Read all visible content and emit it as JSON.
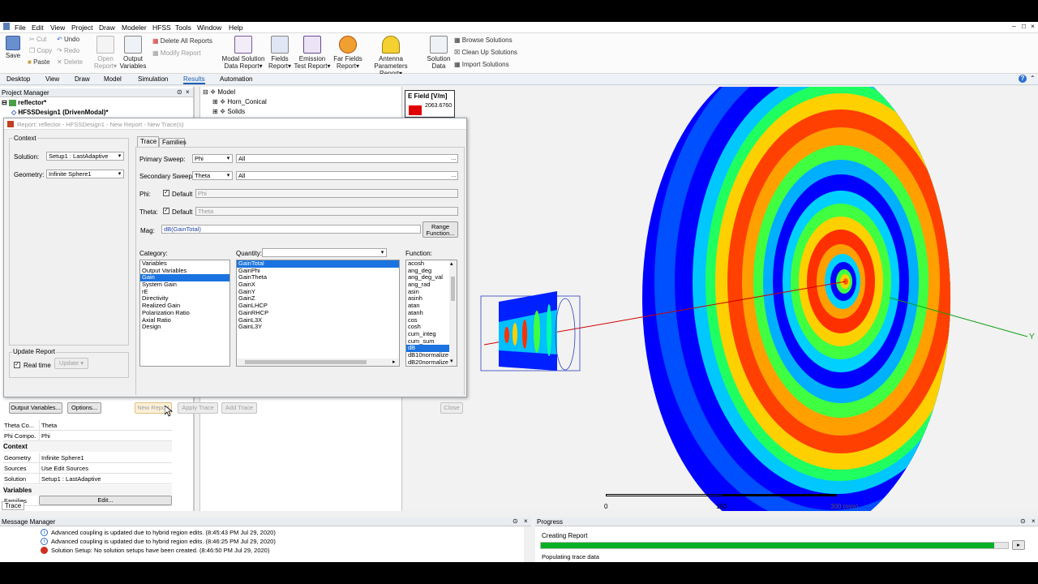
{
  "menu": [
    "File",
    "Edit",
    "View",
    "Project",
    "Draw",
    "Modeler",
    "HFSS",
    "Tools",
    "Window",
    "Help"
  ],
  "ribbon": {
    "save": "Save",
    "cut": "Cut",
    "copy": "Copy",
    "paste": "Paste",
    "undo": "Undo",
    "redo": "Redo",
    "delete": "Delete",
    "open_report": [
      "Open",
      "Report"
    ],
    "output_variables": [
      "Output",
      "Variables"
    ],
    "delete_all_reports": "Delete All Reports",
    "modify_report": "Modify Report",
    "modal_solution": [
      "Modal Solution",
      "Data Report"
    ],
    "fields": [
      "Fields",
      "Report"
    ],
    "emission": [
      "Emission",
      "Test Report"
    ],
    "far_fields": [
      "Far Fields",
      "Report"
    ],
    "antenna": [
      "Antenna",
      "Parameters Report"
    ],
    "solution_data": [
      "Solution",
      "Data"
    ],
    "browse_solutions": "Browse Solutions",
    "clean_up_solutions": "Clean Up Solutions",
    "import_solutions": "Import Solutions"
  },
  "tabs": [
    "Desktop",
    "View",
    "Draw",
    "Model",
    "Simulation",
    "Results",
    "Automation"
  ],
  "project_manager": {
    "title": "Project Manager",
    "project": "reflector*",
    "design": "HFSSDesign1 (DrivenModal)*",
    "tab": "Trace",
    "properties": [
      {
        "k": "Theta Co...",
        "v": "Theta"
      },
      {
        "k": "Phi Compo...",
        "v": "Phi"
      }
    ],
    "context_head": "Context",
    "context_rows": [
      {
        "k": "Geometry",
        "v": "Infinite Sphere1"
      },
      {
        "k": "Sources",
        "v": "Use Edit Sources"
      },
      {
        "k": "Solution",
        "v": "Setup1 : LastAdaptive"
      }
    ],
    "variables_head": "Variables",
    "families_k": "Families",
    "families_v": "Edit..."
  },
  "tree": {
    "model": "Model",
    "horn": "Horn_Conical",
    "solids": "Solids"
  },
  "dialog": {
    "title": "Report: reflector - HFSSDesign1 - New Report - New Trace(s)",
    "context_label": "Context",
    "solution_label": "Solution:",
    "solution_value": "Setup1 : LastAdaptive",
    "geometry_label": "Geometry:",
    "geometry_value": "Infinite Sphere1",
    "tab_trace": "Trace",
    "tab_families": "Families",
    "primary_sweep_label": "Primary Sweep:",
    "primary_sweep_value": "Phi",
    "primary_all": "All",
    "secondary_sweep_label": "Secondary Sweep:",
    "secondary_sweep_value": "Theta",
    "secondary_all": "All",
    "phi_label": "Phi:",
    "phi_default": "Default",
    "phi_value": "Phi",
    "theta_label": "Theta:",
    "theta_default": "Default",
    "theta_value": "Theta",
    "mag_label": "Mag:",
    "mag_value": "dB(GainTotal)",
    "range_function": [
      "Range",
      "Function..."
    ],
    "category_label": "Category:",
    "quantity_label": "Quantity:",
    "function_label": "Function:",
    "categories": [
      "Variables",
      "Output Variables",
      "Gain",
      "System Gain",
      "rE",
      "Directivity",
      "Realized Gain",
      "Polarization Ratio",
      "Axial Ratio",
      "Design"
    ],
    "category_selected": 2,
    "quantities": [
      "GainTotal",
      "GainPhi",
      "GainTheta",
      "GainX",
      "GainY",
      "GainZ",
      "GainLHCP",
      "GainRHCP",
      "GainL3X",
      "GainL3Y"
    ],
    "quantity_selected": 0,
    "functions": [
      "acosh",
      "ang_deg",
      "ang_deg_val",
      "ang_rad",
      "asin",
      "asinh",
      "atan",
      "atanh",
      "cos",
      "cosh",
      "cum_integ",
      "cum_sum",
      "dB",
      "dB10normalize",
      "dB20normalize"
    ],
    "function_selected": 12,
    "update_report": "Update Report",
    "real_time": "Real time",
    "update_btn": "Update",
    "output_variables_btn": "Output Variables...",
    "options_btn": "Options...",
    "new_report_btn": "New Report",
    "apply_trace_btn": "Apply Trace",
    "add_trace_btn": "Add Trace",
    "close_btn": "Close"
  },
  "legend": {
    "title": "E Field [V/m]",
    "value": "2063.6760",
    "color": "#e00000"
  },
  "scale": {
    "zero": "0",
    "mid": "150",
    "end": "300 (mm)"
  },
  "axis_y": "Y",
  "message_manager": {
    "title": "Message Manager",
    "messages": [
      {
        "type": "info",
        "text": "Advanced coupling is updated due to hybrid region edits. (8:45:43 PM  Jul 29, 2020)"
      },
      {
        "type": "info",
        "text": "Advanced coupling is updated due to hybrid region edits. (8:46:25 PM  Jul 29, 2020)"
      },
      {
        "type": "error",
        "text": "Solution Setup: No solution setups have been created. (8:46:50 PM  Jul 29, 2020)"
      }
    ]
  },
  "progress": {
    "title": "Progress",
    "creating": "Creating Report",
    "populating": "Populating trace data",
    "fraction": 0.97
  }
}
